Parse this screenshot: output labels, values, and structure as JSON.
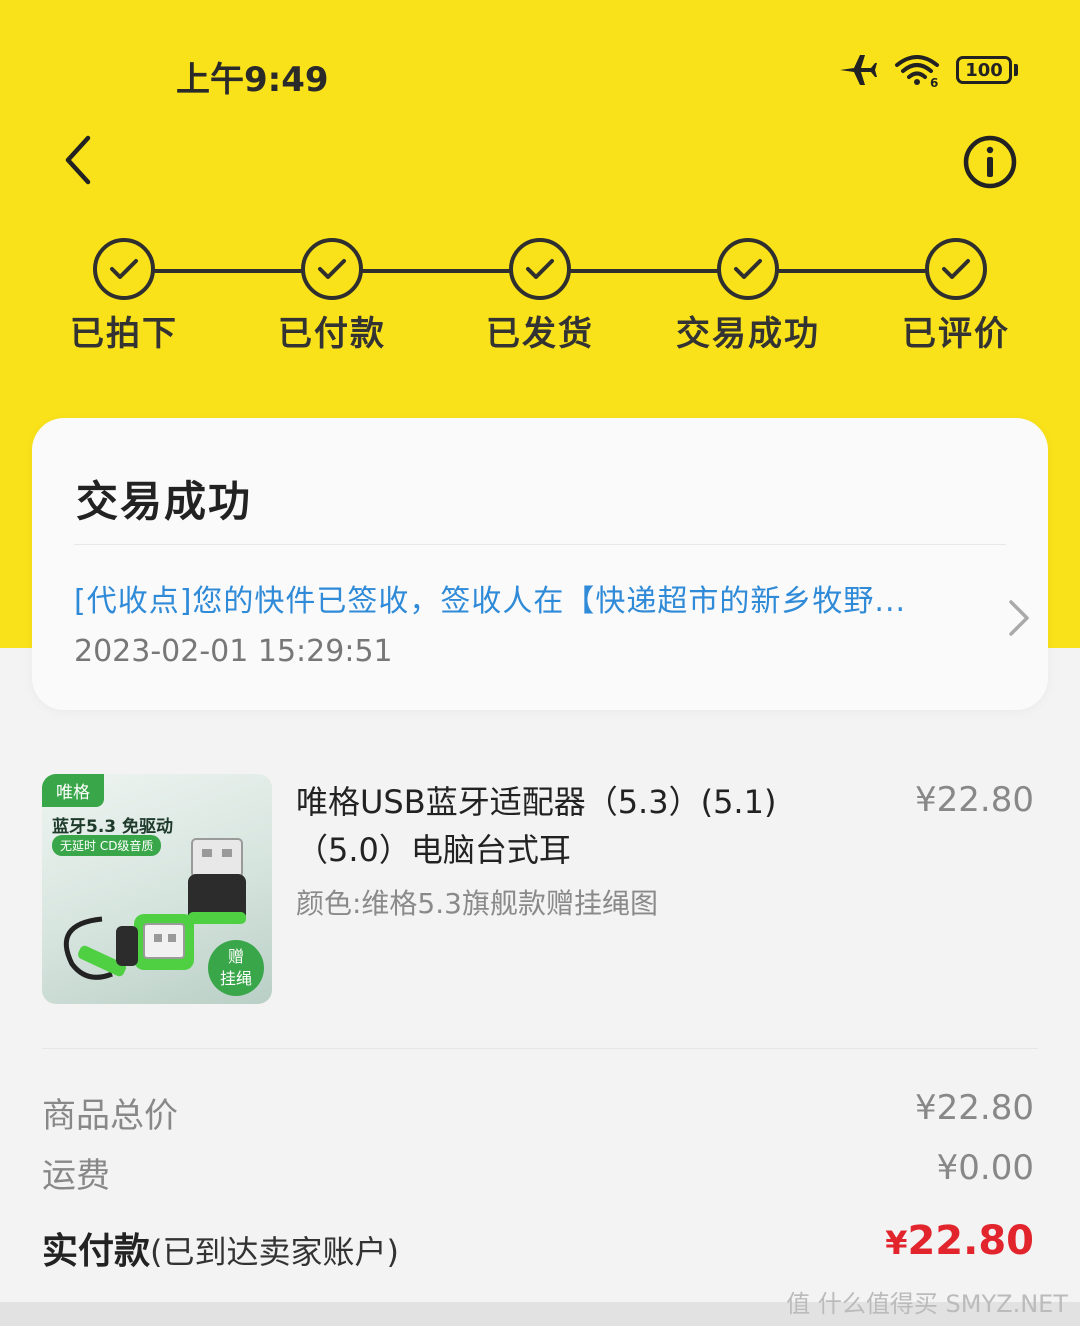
{
  "status_bar": {
    "time": "上午9:49",
    "battery": "100",
    "icons": [
      "airplane-icon",
      "wifi-icon",
      "battery-icon"
    ]
  },
  "nav": {
    "back_icon": "chevron-left-icon",
    "info_icon": "info-icon"
  },
  "progress": {
    "steps": [
      {
        "label": "已拍下",
        "done": true
      },
      {
        "label": "已付款",
        "done": true
      },
      {
        "label": "已发货",
        "done": true
      },
      {
        "label": "交易成功",
        "done": true
      },
      {
        "label": "已评价",
        "done": true
      }
    ]
  },
  "status_card": {
    "title": "交易成功",
    "logistics_text": "[代收点]您的快件已签收，签收人在【快递超市的新乡牧野...",
    "logistics_time": "2023-02-01 15:29:51"
  },
  "product": {
    "title": "唯格USB蓝牙适配器（5.3）(5.1)（5.0）电脑台式耳",
    "price": "¥22.80",
    "spec": "颜色:维格5.3旗舰款赠挂绳图",
    "image": {
      "brand": "唯格",
      "headline": "蓝牙5.3 免驱动",
      "sub": "无延时 CD级音质",
      "gift_line1": "赠",
      "gift_line2": "挂绳"
    }
  },
  "summary": {
    "goods_total_label": "商品总价",
    "goods_total_value": "¥22.80",
    "shipping_label": "运费",
    "shipping_value": "¥0.00",
    "paid_label": "实付款",
    "paid_note": "(已到达卖家账户)",
    "paid_currency": "¥",
    "paid_value": "22.80"
  },
  "watermark": "值 什么值得买 SMYZ.NET",
  "colors": {
    "header_yellow": "#f9e21a",
    "link_blue": "#2f8ad8",
    "price_red": "#e2252c"
  }
}
